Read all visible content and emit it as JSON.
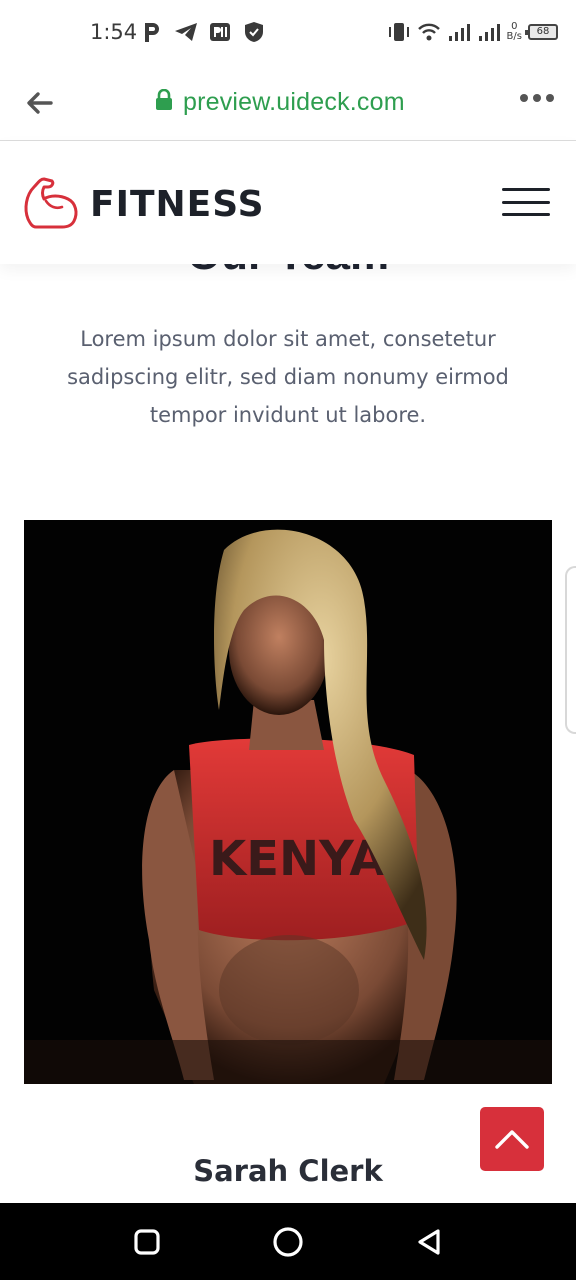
{
  "status_bar": {
    "time": "1:54",
    "left_icons": [
      "parking-icon",
      "telegram-icon",
      "app-icon",
      "shield-icon"
    ],
    "right_icons": [
      "vibrate-icon",
      "wifi-icon",
      "signal-icon",
      "signal-icon"
    ],
    "net_speed_value": "0",
    "net_speed_unit": "B/s",
    "battery": "68"
  },
  "browser": {
    "url": "preview.uideck.com",
    "secure_color": "#2e9e4f"
  },
  "header": {
    "logo_text": "FITNESS",
    "logo_icon": "flexed-arm-icon",
    "brand_color": "#d7303b"
  },
  "team_section": {
    "title": "Our Team",
    "description": "Lorem ipsum dolor sit amet, consetetur sadipscing elitr, sed diam nonumy eirmod tempor invidunt ut labore.",
    "member": {
      "name": "Sarah Clerk",
      "shirt_text": "KENYA"
    }
  },
  "scroll_top": {
    "icon": "chevron-up-icon",
    "color": "#d7303b"
  },
  "nav_bar": {
    "icons": [
      "recent-apps-icon",
      "home-icon",
      "back-icon"
    ]
  }
}
